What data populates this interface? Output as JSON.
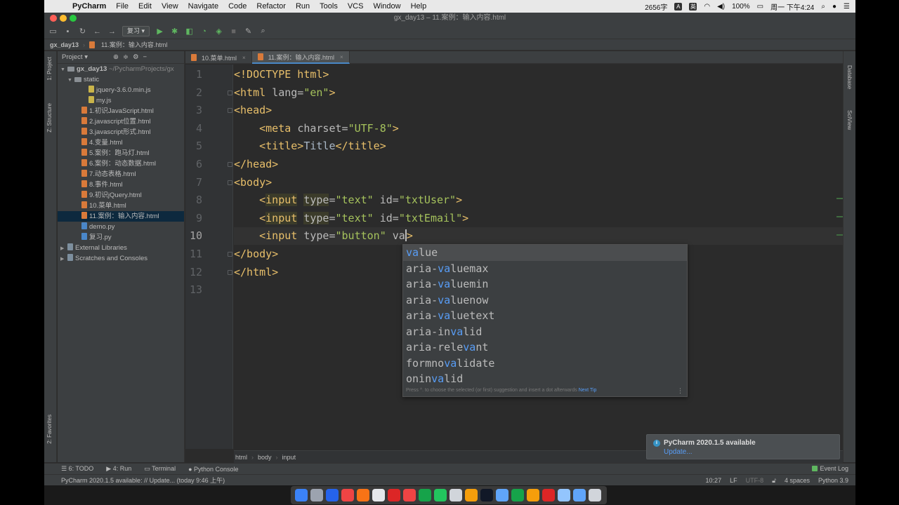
{
  "menubar": {
    "app_name": "PyCharm",
    "menus": [
      "File",
      "Edit",
      "View",
      "Navigate",
      "Code",
      "Refactor",
      "Run",
      "Tools",
      "VCS",
      "Window",
      "Help"
    ],
    "word_count": "2656字",
    "battery": "100%",
    "clock": "周一 下午4:24"
  },
  "window": {
    "title": "gx_day13 – 11.案例：输入内容.html"
  },
  "toolbar": {
    "run_config": "复习"
  },
  "navbar": {
    "project": "gx_day13",
    "file": "11.案例：输入内容.html"
  },
  "left_tabs": {
    "project": "1: Project",
    "structure": "Z: Structure",
    "favorites": "2: Favorites"
  },
  "right_tabs": {
    "database": "Database",
    "sciview": "SciView"
  },
  "project_panel": {
    "header": "Project",
    "items": [
      {
        "label": "gx_day13",
        "suffix": "~/PycharmProjects/gx",
        "icon": "folder-icon",
        "indent": 0,
        "arrow": "▼"
      },
      {
        "label": "static",
        "icon": "folder-icon",
        "indent": 1,
        "arrow": "▼"
      },
      {
        "label": "jquery-3.6.0.min.js",
        "icon": "js-file-icon",
        "indent": 3,
        "arrow": ""
      },
      {
        "label": "my.js",
        "icon": "js-file-icon",
        "indent": 3,
        "arrow": ""
      },
      {
        "label": "1.初识JavaScript.html",
        "icon": "html-file-icon",
        "indent": 2,
        "arrow": ""
      },
      {
        "label": "2.javascript位置.html",
        "icon": "html-file-icon",
        "indent": 2,
        "arrow": ""
      },
      {
        "label": "3.javascript形式.html",
        "icon": "html-file-icon",
        "indent": 2,
        "arrow": ""
      },
      {
        "label": "4.变量.html",
        "icon": "html-file-icon",
        "indent": 2,
        "arrow": ""
      },
      {
        "label": "5.案例：跑马灯.html",
        "icon": "html-file-icon",
        "indent": 2,
        "arrow": ""
      },
      {
        "label": "6.案例：动态数据.html",
        "icon": "html-file-icon",
        "indent": 2,
        "arrow": ""
      },
      {
        "label": "7.动态表格.html",
        "icon": "html-file-icon",
        "indent": 2,
        "arrow": ""
      },
      {
        "label": "8.事件.html",
        "icon": "html-file-icon",
        "indent": 2,
        "arrow": ""
      },
      {
        "label": "9.初识jQuery.html",
        "icon": "html-file-icon",
        "indent": 2,
        "arrow": ""
      },
      {
        "label": "10.菜单.html",
        "icon": "html-file-icon",
        "indent": 2,
        "arrow": ""
      },
      {
        "label": "11.案例：输入内容.html",
        "icon": "html-file-icon",
        "indent": 2,
        "arrow": "",
        "selected": true
      },
      {
        "label": "demo.py",
        "icon": "py-file-icon",
        "indent": 2,
        "arrow": ""
      },
      {
        "label": "复习.py",
        "icon": "py-file-icon",
        "indent": 2,
        "arrow": ""
      },
      {
        "label": "External Libraries",
        "icon": "library-icon",
        "indent": 0,
        "arrow": "▶"
      },
      {
        "label": "Scratches and Consoles",
        "icon": "scratch-icon",
        "indent": 0,
        "arrow": "▶"
      }
    ]
  },
  "editor_tabs": [
    {
      "label": "10.菜单.html",
      "active": false
    },
    {
      "label": "11.案例：输入内容.html",
      "active": true
    }
  ],
  "editor": {
    "current_line": 10,
    "lines": [
      [
        [
          "tg",
          "<!DOCTYPE html>"
        ]
      ],
      [
        [
          "tg",
          "<html "
        ],
        [
          "at",
          "lang="
        ],
        [
          "sv",
          "\"en\""
        ],
        [
          "tg",
          ">"
        ]
      ],
      [
        [
          "tg",
          "<head>"
        ]
      ],
      [
        [
          "tx",
          "    "
        ],
        [
          "tg",
          "<meta "
        ],
        [
          "at",
          "charset="
        ],
        [
          "sv",
          "\"UTF-8\""
        ],
        [
          "tg",
          ">"
        ]
      ],
      [
        [
          "tx",
          "    "
        ],
        [
          "tg",
          "<title>"
        ],
        [
          "tx",
          "Title"
        ],
        [
          "tg",
          "</title>"
        ]
      ],
      [
        [
          "tg",
          "</head>"
        ]
      ],
      [
        [
          "tg",
          "<body>"
        ]
      ],
      [
        [
          "tx",
          "    "
        ],
        [
          "tg",
          "<"
        ],
        [
          "tg hl",
          "input"
        ],
        [
          "at",
          " "
        ],
        [
          "at hl",
          "type"
        ],
        [
          "at",
          "="
        ],
        [
          "sv",
          "\"text\""
        ],
        [
          "at",
          " id="
        ],
        [
          "sv",
          "\"txtUser\""
        ],
        [
          "tg",
          ">"
        ]
      ],
      [
        [
          "tx",
          "    "
        ],
        [
          "tg",
          "<"
        ],
        [
          "tg hl",
          "input"
        ],
        [
          "at",
          " "
        ],
        [
          "at hl",
          "type"
        ],
        [
          "at",
          "="
        ],
        [
          "sv",
          "\"text\""
        ],
        [
          "at",
          " id="
        ],
        [
          "sv",
          "\"txtEmail\""
        ],
        [
          "tg",
          ">"
        ]
      ],
      [
        [
          "tx",
          "    "
        ],
        [
          "tg",
          "<input "
        ],
        [
          "at",
          "type="
        ],
        [
          "sv",
          "\"button\""
        ],
        [
          "at",
          " va"
        ],
        [
          "caret",
          ""
        ],
        [
          "tg",
          ">"
        ]
      ],
      [
        [
          "tg",
          "</body>"
        ]
      ],
      [
        [
          "tg",
          "</html>"
        ]
      ],
      []
    ]
  },
  "completion": {
    "items": [
      {
        "pre": "",
        "match": "va",
        "post": "lue"
      },
      {
        "pre": "aria-",
        "match": "va",
        "post": "luemax"
      },
      {
        "pre": "aria-",
        "match": "va",
        "post": "luemin"
      },
      {
        "pre": "aria-",
        "match": "va",
        "post": "luenow"
      },
      {
        "pre": "aria-",
        "match": "va",
        "post": "luetext"
      },
      {
        "pre": "aria-in",
        "match": "va",
        "post": "lid"
      },
      {
        "pre": "aria-rele",
        "match": "va",
        "post": "nt"
      },
      {
        "pre": "formno",
        "match": "va",
        "post": "lidate"
      },
      {
        "pre": "onin",
        "match": "va",
        "post": "lid"
      }
    ],
    "footer": "Press ^. to choose the selected (or first) suggestion and insert a dot afterwards",
    "next_tip": "Next Tip"
  },
  "breadcrumbs": [
    "html",
    "body",
    "input"
  ],
  "notification": {
    "title": "PyCharm 2020.1.5 available",
    "link": "Update..."
  },
  "tool_windows": {
    "todo": "6: TODO",
    "run": "4: Run",
    "terminal": "Terminal",
    "console": "Python Console",
    "event_log": "Event Log"
  },
  "status": {
    "message": "PyCharm 2020.1.5 available: // Update... (today 9:46 上午)",
    "position": "10:27",
    "line_sep": "LF",
    "encoding": "UTF-8",
    "indent": "4 spaces",
    "interpreter": "Python 3.9"
  },
  "dock": {
    "colors": [
      "#3b82f6",
      "#9ca3af",
      "#2563eb",
      "#ef4444",
      "#f97316",
      "#e5e7eb",
      "#dc2626",
      "#ef4444",
      "#16a34a",
      "#22c55e",
      "#d1d5db",
      "#f59e0b",
      "#111827",
      "#60a5fa",
      "#16a34a",
      "#f59e0b",
      "#dc2626",
      "#93c5fd",
      "#60a5fa",
      "#d1d5db"
    ]
  }
}
